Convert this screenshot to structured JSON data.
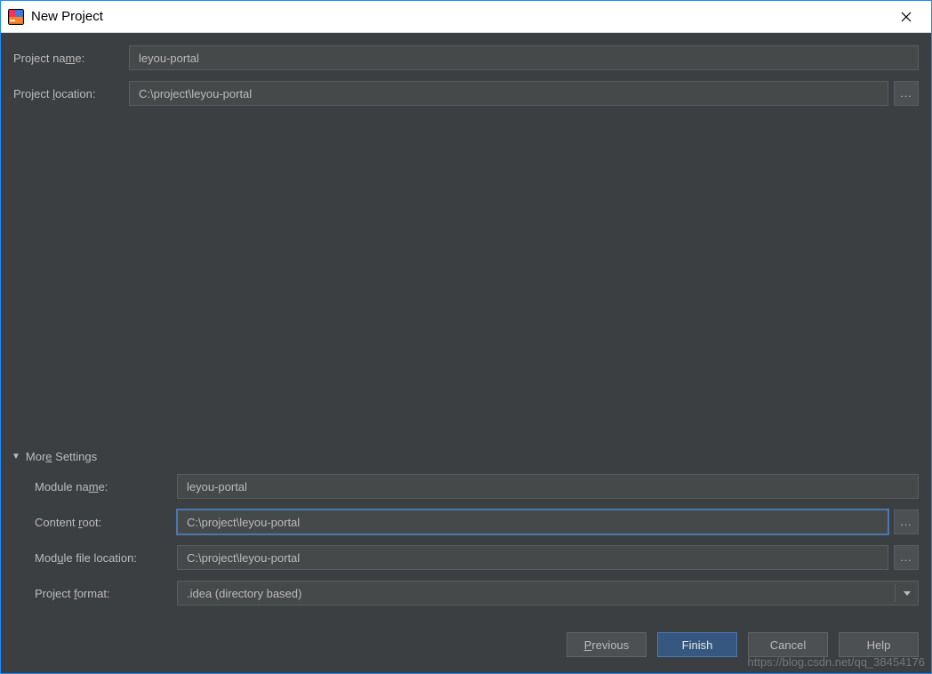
{
  "window": {
    "title": "New Project"
  },
  "fields": {
    "project_name_label": "Project name:",
    "project_name_value": "leyou-portal",
    "project_location_label": "Project location:",
    "project_location_value": "C:\\project\\leyou-portal"
  },
  "more_settings": {
    "header": "More Settings",
    "module_name_label": "Module name:",
    "module_name_value": "leyou-portal",
    "content_root_label": "Content root:",
    "content_root_value": "C:\\project\\leyou-portal",
    "module_file_location_label": "Module file location:",
    "module_file_location_value": "C:\\project\\leyou-portal",
    "project_format_label": "Project format:",
    "project_format_value": ".idea (directory based)"
  },
  "buttons": {
    "previous": "Previous",
    "finish": "Finish",
    "cancel": "Cancel",
    "help": "Help",
    "browse": "..."
  },
  "watermark": "https://blog.csdn.net/qq_38454176"
}
